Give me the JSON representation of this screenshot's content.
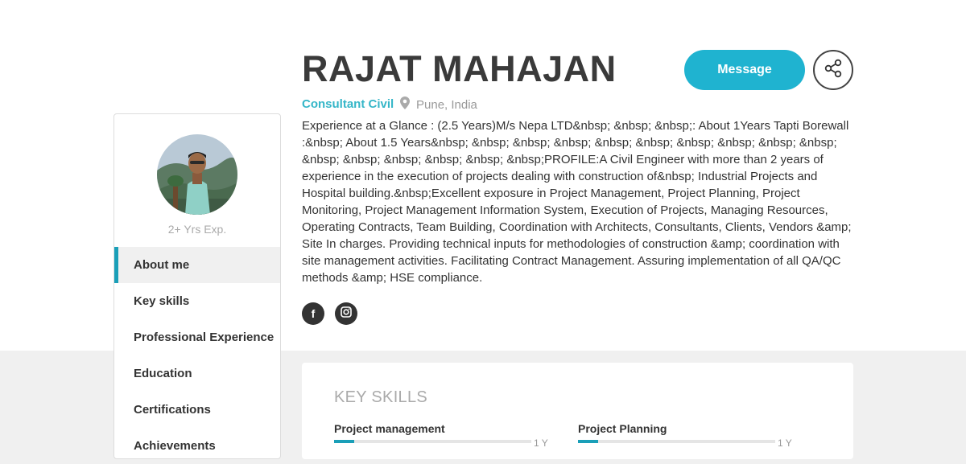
{
  "profile": {
    "name": "RAJAT MAHAJAN",
    "role": "Consultant Civil",
    "location": "Pune, India",
    "experience": "2+ Yrs Exp.",
    "about": "Experience at a Glance : (2.5 Years)M/s Nepa LTD&nbsp; &nbsp; &nbsp;: About 1Years Tapti Borewall :&nbsp; About 1.5 Years&nbsp; &nbsp; &nbsp; &nbsp; &nbsp; &nbsp; &nbsp; &nbsp; &nbsp; &nbsp; &nbsp; &nbsp; &nbsp; &nbsp; &nbsp; &nbsp;PROFILE:A Civil Engineer with more than 2 years of experience in the execution of projects dealing with construction of&nbsp; Industrial Projects and Hospital building.&nbsp;Excellent exposure in Project Management, Project Planning, Project Monitoring, Project Management Information System, Execution of Projects, Managing Resources, Operating Contracts, Team Building, Coordination with Architects, Consultants, Clients, Vendors &amp; Site In charges. Providing technical inputs for methodologies of construction &amp; coordination with site management activities. Facilitating Contract Management. Assuring implementation of all QA/QC methods &amp; HSE compliance."
  },
  "actions": {
    "message_label": "Message",
    "share_icon": "share-icon"
  },
  "social": [
    {
      "icon": "facebook-icon",
      "glyph": "f"
    },
    {
      "icon": "instagram-icon"
    }
  ],
  "nav": {
    "items": [
      {
        "label": "About me",
        "active": true
      },
      {
        "label": "Key skills"
      },
      {
        "label": "Professional Experience"
      },
      {
        "label": "Education"
      },
      {
        "label": "Certifications"
      },
      {
        "label": "Achievements"
      }
    ]
  },
  "skills": {
    "title": "KEY SKILLS",
    "items": [
      {
        "label": "Project management",
        "years": "1 Y",
        "level": 0.1
      },
      {
        "label": "Project Planning",
        "years": "1 Y",
        "level": 0.1
      }
    ]
  },
  "colors": {
    "accent": "#1fb3d0",
    "role": "#35b6c8",
    "active_marker": "#1a9fb8"
  }
}
